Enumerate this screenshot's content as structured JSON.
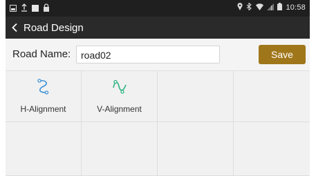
{
  "status_bar": {
    "time": "10:58",
    "left_icons": [
      "notification-icon",
      "upload-icon",
      "square-icon",
      "lock-icon"
    ],
    "right_icons": [
      "location-icon",
      "bluetooth-icon",
      "wifi-icon",
      "signal-icon",
      "battery-icon"
    ]
  },
  "app_bar": {
    "back_icon": "chevron-left-icon",
    "title": "Road Design"
  },
  "form": {
    "road_name_label": "Road Name:",
    "road_name_value": "road02",
    "save_label": "Save"
  },
  "tools": [
    {
      "label": "H-Alignment",
      "icon": "h-alignment-icon",
      "color": "#3a8fd8"
    },
    {
      "label": "V-Alignment",
      "icon": "v-alignment-icon",
      "color": "#2bb07f"
    }
  ],
  "colors": {
    "status_bar": "#1f1f1f",
    "app_bar": "#2a2a2a",
    "save_button": "#a0761a"
  }
}
